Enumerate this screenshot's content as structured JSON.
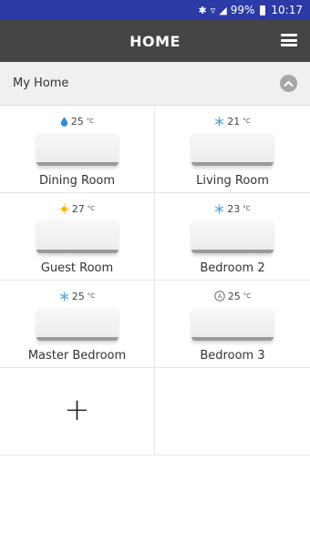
{
  "status": {
    "battery": "99%",
    "time": "10:17"
  },
  "appbar": {
    "title": "HOME"
  },
  "section": {
    "title": "My Home"
  },
  "rooms": [
    {
      "name": "Dining Room",
      "temp": "25",
      "unit": "°C",
      "mode_icon": "drop-icon"
    },
    {
      "name": "Living Room",
      "temp": "21",
      "unit": "°C",
      "mode_icon": "snowflake-icon"
    },
    {
      "name": "Guest Room",
      "temp": "27",
      "unit": "°C",
      "mode_icon": "sun-icon"
    },
    {
      "name": "Bedroom 2",
      "temp": "23",
      "unit": "°C",
      "mode_icon": "snowflake-icon"
    },
    {
      "name": "Master Bedroom",
      "temp": "25",
      "unit": "°C",
      "mode_icon": "snowflake-icon"
    },
    {
      "name": "Bedroom 3",
      "temp": "25",
      "unit": "°C",
      "mode_icon": "auto-icon"
    }
  ],
  "add_label": "+",
  "colors": {
    "statusbar": "#2b3aa6",
    "appbar": "#444444",
    "drop": "#2f8fd6",
    "snow": "#4aa7e0",
    "sun": "#f5b800"
  }
}
